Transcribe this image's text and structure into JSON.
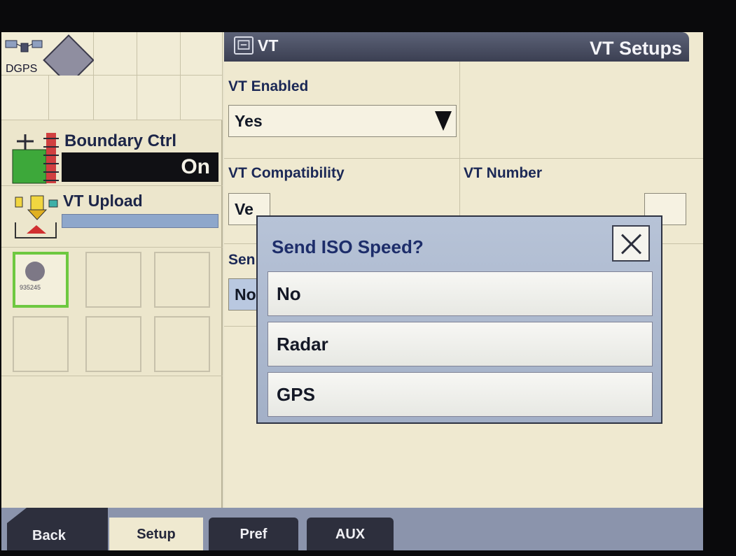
{
  "left": {
    "dgps_label": "DGPS",
    "boundary": {
      "title": "Boundary Ctrl",
      "value": "On"
    },
    "upload": {
      "title": "VT Upload",
      "progress": 1.0
    },
    "tiles": [
      {
        "number": "935245",
        "selected": true
      }
    ]
  },
  "header": {
    "title": "VT",
    "setups": "VT Setups"
  },
  "fields": {
    "vt_enabled": {
      "label": "VT Enabled",
      "value": "Yes"
    },
    "vt_compat": {
      "label": "VT Compatibility",
      "value": "Ve"
    },
    "vt_number": {
      "label": "VT Number"
    },
    "send": {
      "label": "Sen",
      "value": "No"
    }
  },
  "modal": {
    "title": "Send ISO Speed?",
    "options": [
      "No",
      "Radar",
      "GPS"
    ]
  },
  "tabs": {
    "back": "Back",
    "setup": "Setup",
    "pref": "Pref",
    "aux": "AUX"
  },
  "colors": {
    "accent": "#6ec840",
    "header": "#3b3f52",
    "modal": "#a3b0c7"
  }
}
